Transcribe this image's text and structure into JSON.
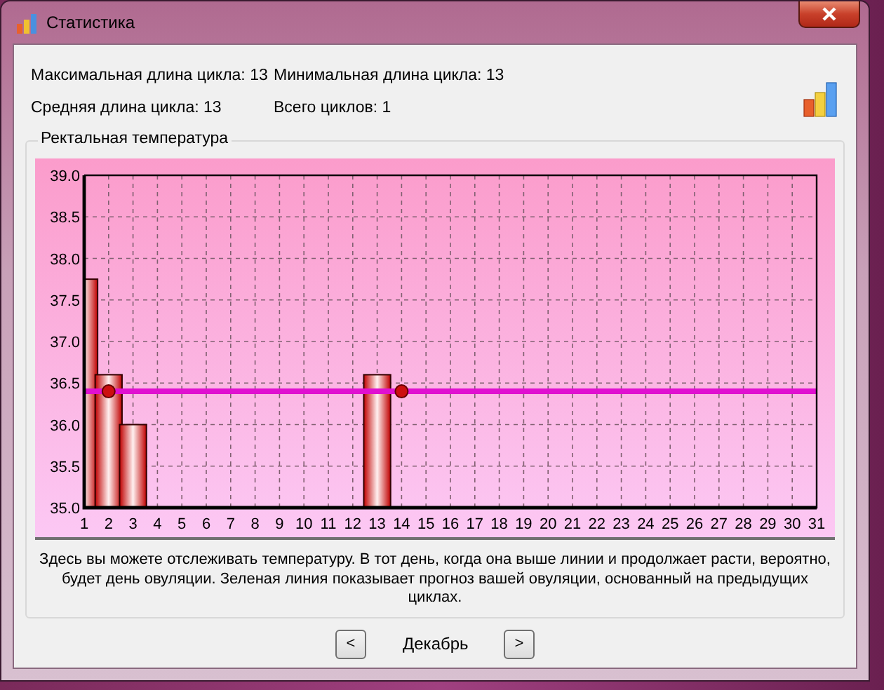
{
  "window": {
    "title": "Статистика"
  },
  "stats": [
    [
      "Максимальная длина цикла: 13",
      "Минимальная длина цикла: 13"
    ],
    [
      "Средняя длина цикла: 13",
      "Всего циклов: 1"
    ]
  ],
  "group": {
    "title": "Ректальная температура",
    "chart_data": {
      "type": "bar",
      "grid": true,
      "x": [
        1,
        2,
        3,
        4,
        5,
        6,
        7,
        8,
        9,
        10,
        11,
        12,
        13,
        14,
        15,
        16,
        17,
        18,
        19,
        20,
        21,
        22,
        23,
        24,
        25,
        26,
        27,
        28,
        29,
        30,
        31
      ],
      "xlim": [
        1,
        31
      ],
      "ylim": [
        35,
        39
      ],
      "xticks": [
        1,
        2,
        3,
        4,
        5,
        6,
        7,
        8,
        9,
        10,
        11,
        12,
        13,
        14,
        15,
        16,
        17,
        18,
        19,
        20,
        21,
        22,
        23,
        24,
        25,
        26,
        27,
        28,
        29,
        30,
        31
      ],
      "yticks": [
        {
          "value": 35,
          "label": "35.0"
        },
        {
          "value": 35.5,
          "label": "35.5"
        },
        {
          "value": 36,
          "label": "36.0"
        },
        {
          "value": 36.5,
          "label": "36.5"
        },
        {
          "value": 37,
          "label": "37.0"
        },
        {
          "value": 37.5,
          "label": "37.5"
        },
        {
          "value": 38,
          "label": "38.0"
        },
        {
          "value": 38.5,
          "label": "38.5"
        },
        {
          "value": 39,
          "label": "39.0"
        }
      ],
      "series": [
        {
          "color": "#e02020",
          "values": [
            37.75,
            36.6,
            36.0,
            null,
            null,
            null,
            null,
            null,
            null,
            null,
            null,
            null,
            36.6,
            null,
            null,
            null,
            null,
            null,
            null,
            null,
            null,
            null,
            null,
            null,
            null,
            null,
            null,
            null,
            null,
            null,
            null
          ]
        },
        {
          "type": "line",
          "color": "#e010d0",
          "values": [
            36.4,
            36.4,
            36.4,
            36.4,
            36.4,
            36.4,
            36.4,
            36.4,
            36.4,
            36.4,
            36.4,
            36.4,
            36.4,
            36.4,
            36.4,
            36.4,
            36.4,
            36.4,
            36.4,
            36.4,
            36.4,
            36.4,
            36.4,
            36.4,
            36.4,
            36.4,
            36.4,
            36.4,
            36.4,
            36.4,
            36.4
          ]
        },
        {
          "type": "scatter",
          "color": "#cc1010",
          "values": [
            null,
            36.4,
            null,
            null,
            null,
            null,
            null,
            null,
            null,
            null,
            null,
            null,
            null,
            36.4,
            null,
            null,
            null,
            null,
            null,
            null,
            null,
            null,
            null,
            null,
            null,
            null,
            null,
            null,
            null,
            null,
            null
          ]
        }
      ]
    },
    "description": "Здесь вы можете отслеживать температуру. В тот день, когда она выше линии и продолжает расти, вероятно, будет день овуляции. Зеленая линия показывает прогноз вашей овуляции, основанный на предыдущих циклах."
  },
  "nav": {
    "prev": "<",
    "month": "Декабрь",
    "next": ">"
  }
}
